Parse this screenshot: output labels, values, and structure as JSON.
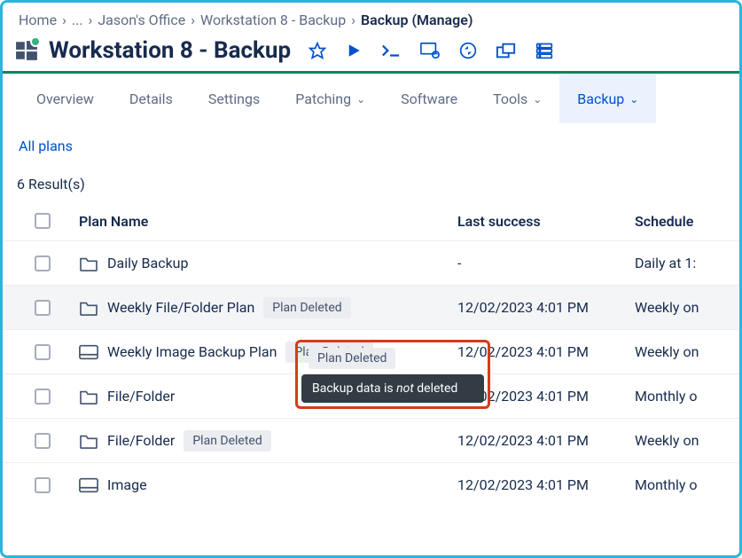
{
  "breadcrumb": {
    "items": [
      "Home",
      "...",
      "Jason's Office",
      "Workstation 8 - Backup",
      "Backup (Manage)"
    ]
  },
  "header": {
    "title": "Workstation 8 - Backup"
  },
  "tabs": {
    "overview": "Overview",
    "details": "Details",
    "settings": "Settings",
    "patching": "Patching",
    "software": "Software",
    "tools": "Tools",
    "backup": "Backup"
  },
  "sublink": {
    "all_plans": "All plans"
  },
  "results": {
    "count_text": "6 Result(s)"
  },
  "columns": {
    "name": "Plan Name",
    "last": "Last success",
    "sched": "Schedule"
  },
  "badges": {
    "plan_deleted": "Plan Deleted"
  },
  "tooltip": {
    "prefix": "Backup data is ",
    "em": "not",
    "suffix": " deleted"
  },
  "rows": [
    {
      "icon": "folder",
      "name": "Daily Backup",
      "badge": null,
      "last": "-",
      "sched": "Daily at 1:"
    },
    {
      "icon": "folder",
      "name": "Weekly File/Folder Plan",
      "badge": "plan_deleted",
      "last": "12/02/2023 4:01 PM",
      "sched": "Weekly on",
      "highlight": true
    },
    {
      "icon": "image",
      "name": "Weekly Image Backup Plan",
      "badge": "plan_deleted",
      "last": "12/02/2023 4:01 PM",
      "sched": "Weekly on"
    },
    {
      "icon": "folder",
      "name": "File/Folder",
      "badge": null,
      "last": "12/02/2023 4:01 PM",
      "sched": "Monthly o"
    },
    {
      "icon": "folder",
      "name": "File/Folder",
      "badge": "plan_deleted",
      "last": "12/02/2023 4:01 PM",
      "sched": "Weekly on"
    },
    {
      "icon": "image",
      "name": "Image",
      "badge": null,
      "last": "12/02/2023 4:01 PM",
      "sched": "Monthly o"
    }
  ]
}
